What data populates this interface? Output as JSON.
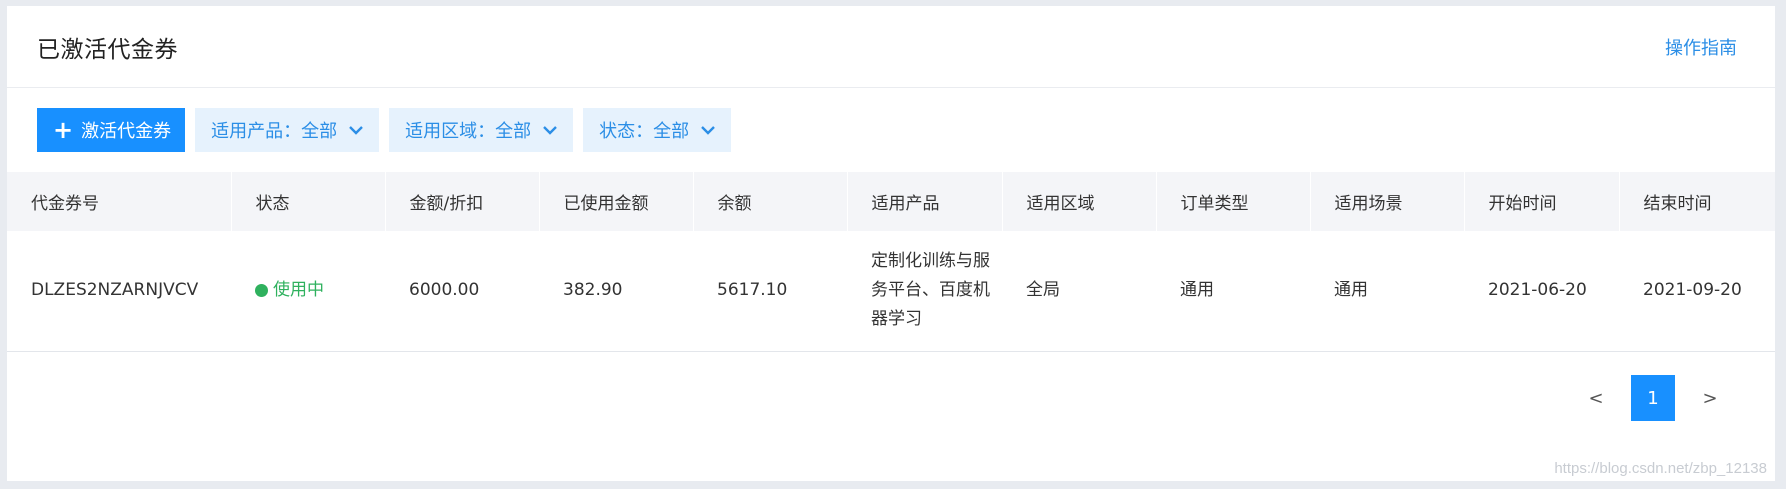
{
  "header": {
    "title": "已激活代金券",
    "guide_label": "操作指南"
  },
  "toolbar": {
    "activate_label": "激活代金券",
    "filters": [
      {
        "label": "适用产品：全部"
      },
      {
        "label": "适用区域：全部"
      },
      {
        "label": "状态：全部"
      }
    ]
  },
  "table": {
    "columns": [
      "代金券号",
      "状态",
      "金额/折扣",
      "已使用金额",
      "余额",
      "适用产品",
      "适用区域",
      "订单类型",
      "适用场景",
      "开始时间",
      "结束时间"
    ],
    "rows": [
      {
        "id": "DLZES2NZARNJVCV",
        "status": "使用中",
        "amount": "6000.00",
        "used": "382.90",
        "balance": "5617.10",
        "product": "定制化训练与服务平台、百度机器学习",
        "region": "全局",
        "order_type": "通用",
        "scene": "通用",
        "start": "2021-06-20",
        "end": "2021-09-20"
      }
    ]
  },
  "pagination": {
    "prev": "<",
    "current": "1",
    "next": ">"
  },
  "watermark": "https://blog.csdn.net/zbp_12138",
  "colors": {
    "primary": "#1890ff",
    "filter_bg": "#e6f2fd",
    "status_active": "#2fb15e",
    "header_bg": "#f4f5f8"
  }
}
